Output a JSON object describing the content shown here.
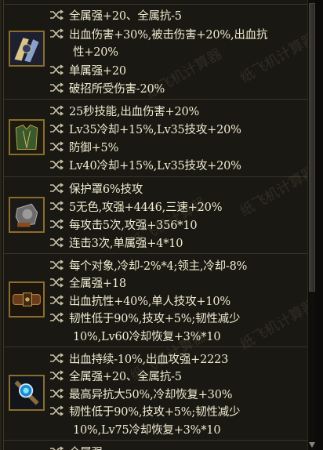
{
  "sections": [
    {
      "icon": "shoulder-armor-icon",
      "lines": [
        {
          "text": "全属强+20、全属抗-5"
        },
        {
          "text": "出血伤害+30%,被击伤害+20%,出血抗"
        },
        {
          "text": "性+20%",
          "continuation": true
        },
        {
          "text": "单属强+20"
        },
        {
          "text": "破招所受伤害-20%"
        }
      ]
    },
    {
      "icon": "chest-armor-icon",
      "lines": [
        {
          "text": "25秒技能,出血伤害+20%"
        },
        {
          "text": "Lv35冷却+15%,Lv35技攻+20%"
        },
        {
          "text": "防御+5%"
        },
        {
          "text": "Lv40冷却+15%,Lv35技攻+20%"
        }
      ]
    },
    {
      "icon": "gauntlet-icon",
      "lines": [
        {
          "text": "保护罩6%技攻"
        },
        {
          "text": "5无色,攻强+4446,三速+20%"
        },
        {
          "text": "每攻击5次,攻强+356*10"
        },
        {
          "text": "连击3次,单属强+4*10"
        }
      ]
    },
    {
      "icon": "belt-icon",
      "lines": [
        {
          "text": "每个对象,冷却-2%*4;领主,冷却-8%"
        },
        {
          "text": "全属强+18"
        },
        {
          "text": "出血抗性+40%,单人技攻+10%"
        },
        {
          "text": "韧性低于90%,技攻+5%;韧性减少"
        },
        {
          "text": "10%,Lv60冷却恢复+3%*10",
          "continuation": true
        }
      ]
    },
    {
      "icon": "amulet-icon",
      "lines": [
        {
          "text": "出血持续-10%,出血攻强+2223"
        },
        {
          "text": "全属强+20、全属抗-5"
        },
        {
          "text": "最高异抗大50%,冷却恢复+30%"
        },
        {
          "text": "韧性低于90%,技攻+5%;韧性减少"
        },
        {
          "text": "10%,Lv75冷却恢复+3%*10",
          "continuation": true
        }
      ]
    },
    {
      "icon": "",
      "lines": [
        {
          "text": "全属强"
        }
      ]
    }
  ],
  "watermark": "纸飞机计算器",
  "colors": {
    "text": "#f0ecd2",
    "shuffle": "#c9c2a8",
    "icon_border": "#8a6d2d",
    "background": "#1a1812"
  }
}
